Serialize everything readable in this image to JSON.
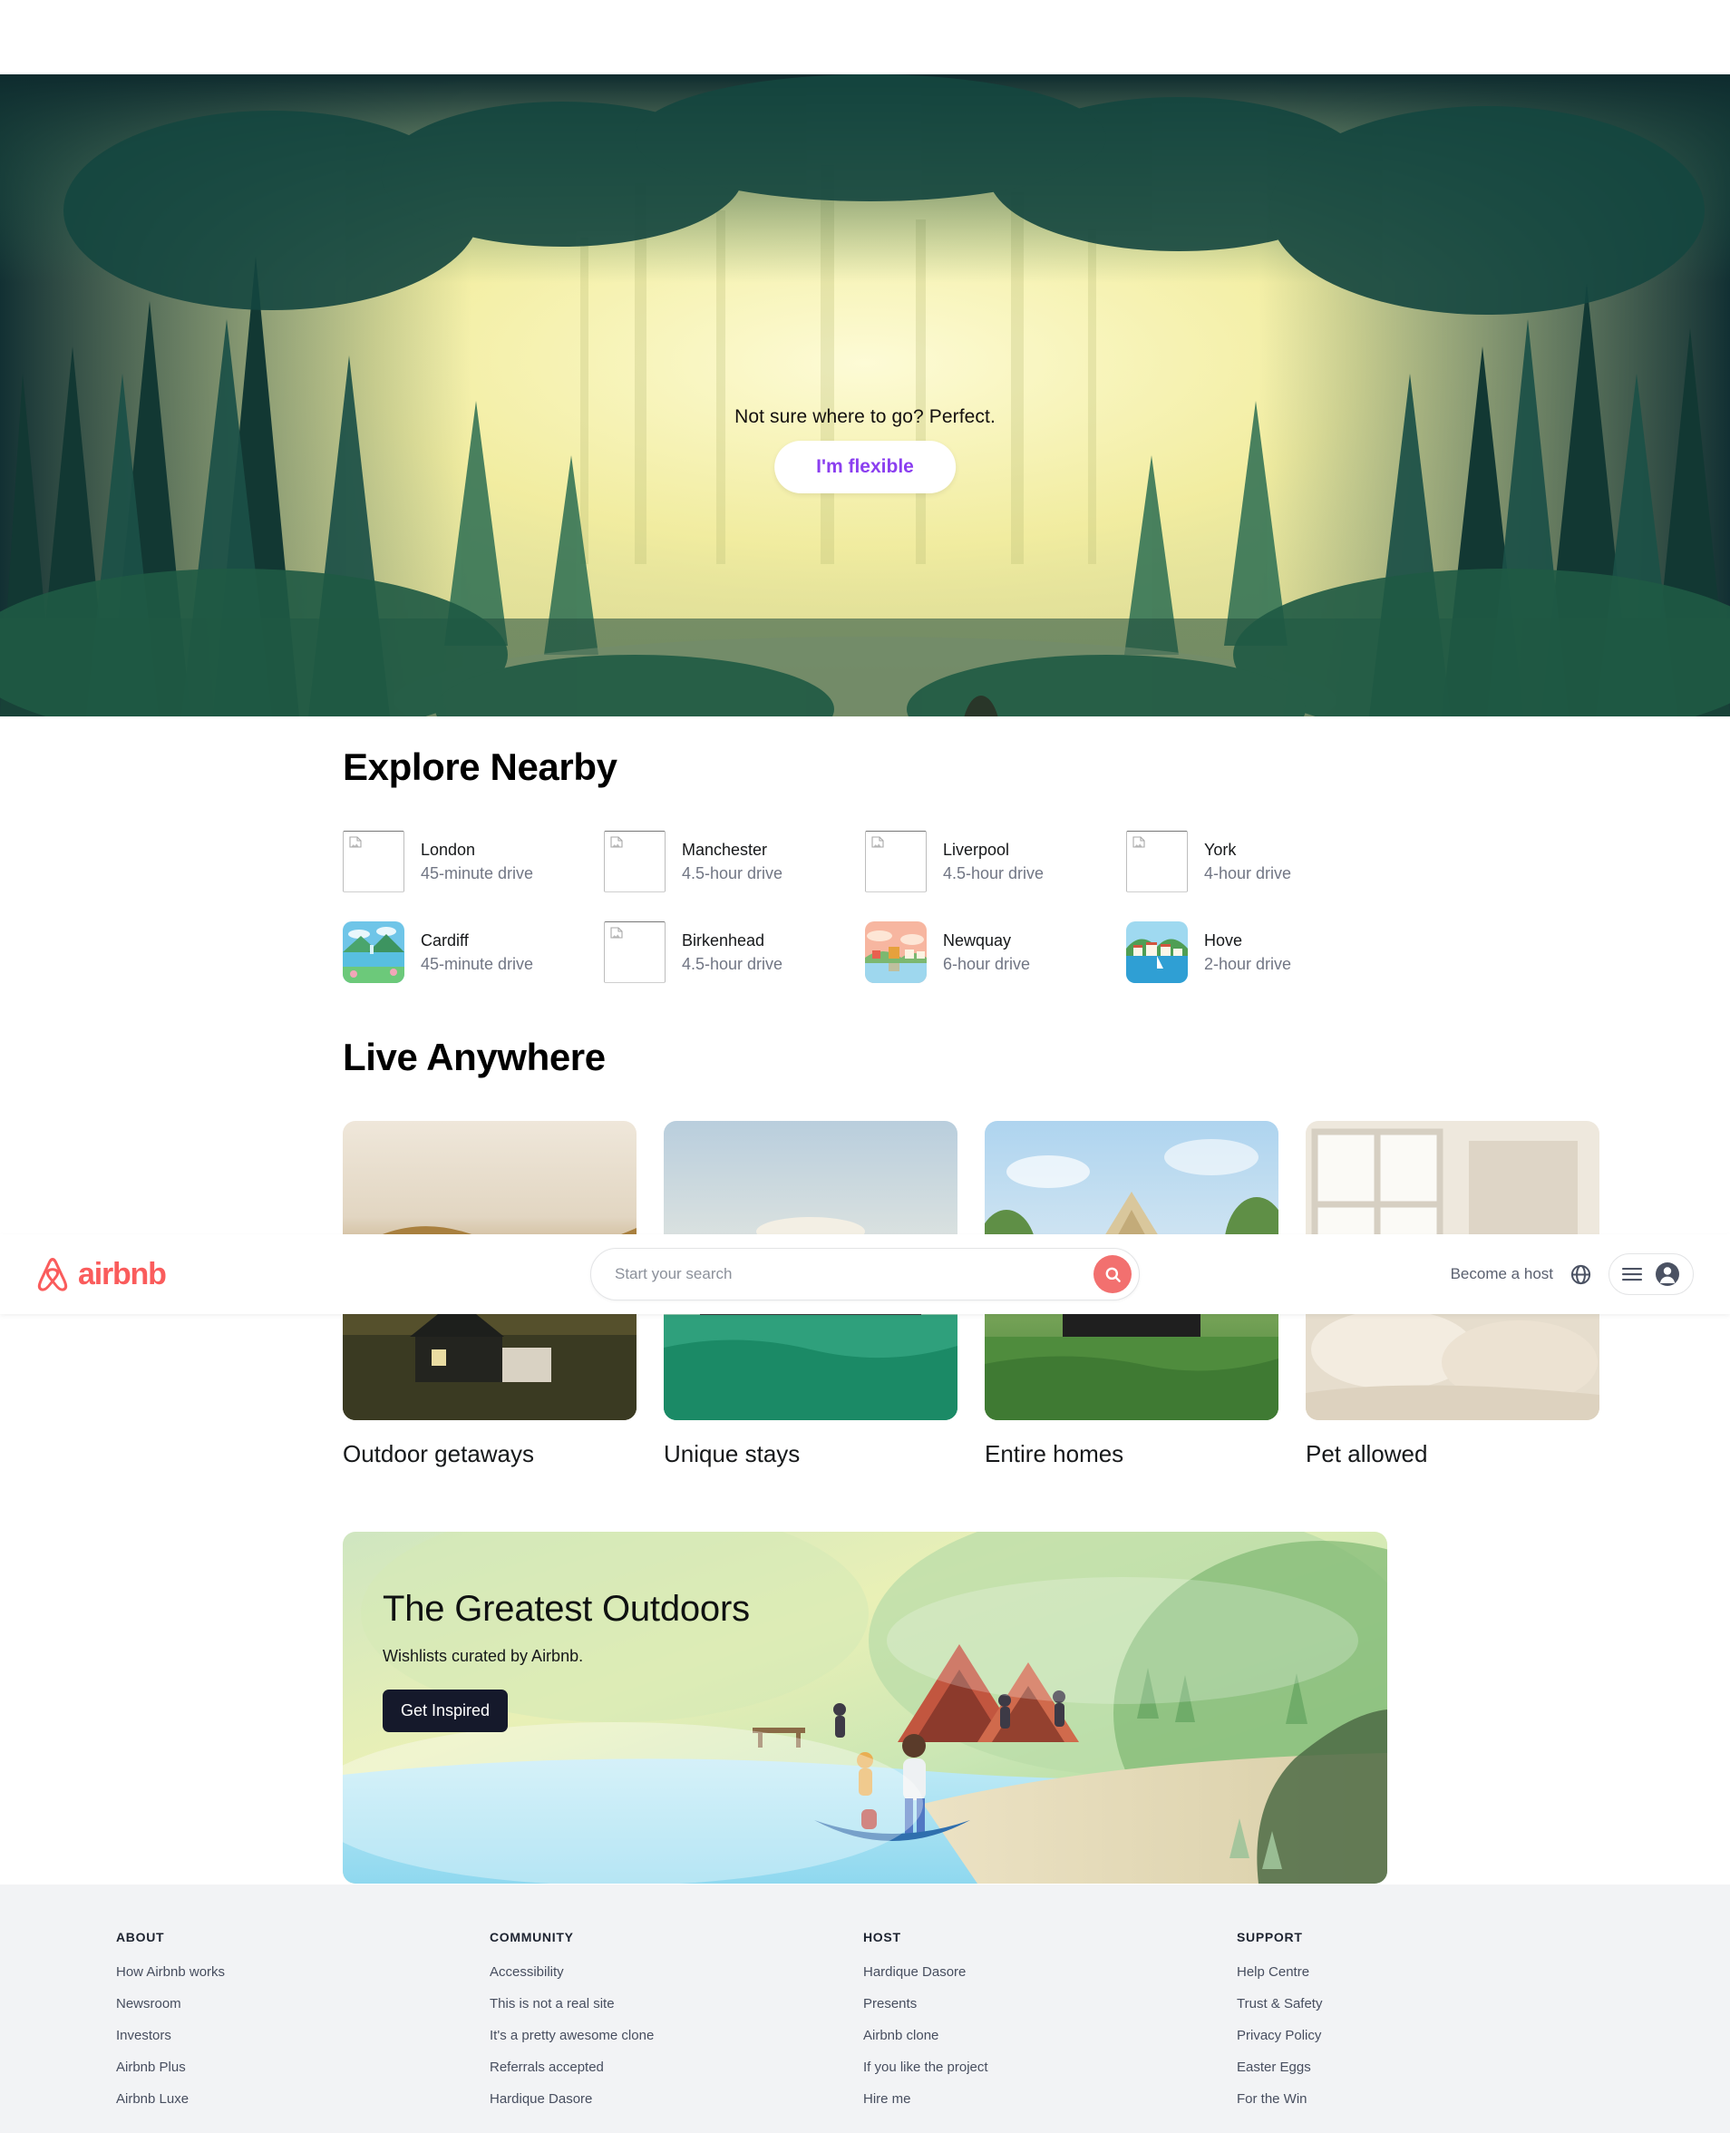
{
  "hero": {
    "tagline": "Not sure where to go? Perfect.",
    "button_label": "I'm flexible",
    "button_color": "#8b3ff0"
  },
  "header": {
    "brand_name": "airbnb",
    "brand_color": "#fa5c5c",
    "search_placeholder": "Start your search",
    "search_value": "",
    "become_host_label": "Become a host",
    "globe_icon": "globe-icon",
    "menu_icon": "hamburger-icon",
    "avatar_icon": "user-avatar-icon",
    "search_icon": "search-icon",
    "search_button_color": "#f2706f"
  },
  "explore": {
    "title": "Explore Nearby",
    "cards": [
      {
        "city": "London",
        "distance": "45-minute drive",
        "image": "broken"
      },
      {
        "city": "Manchester",
        "distance": "4.5-hour drive",
        "image": "broken"
      },
      {
        "city": "Liverpool",
        "distance": "4.5-hour drive",
        "image": "broken"
      },
      {
        "city": "York",
        "distance": "4-hour drive",
        "image": "broken"
      },
      {
        "city": "Cardiff",
        "distance": "45-minute drive",
        "image": "lake-mountains"
      },
      {
        "city": "Birkenhead",
        "distance": "4.5-hour drive",
        "image": "broken"
      },
      {
        "city": "Newquay",
        "distance": "6-hour drive",
        "image": "sunset-village"
      },
      {
        "city": "Hove",
        "distance": "2-hour drive",
        "image": "harbour-town"
      }
    ]
  },
  "live": {
    "title": "Live Anywhere",
    "cards": [
      {
        "label": "Outdoor getaways",
        "image": "hillside-cabin"
      },
      {
        "label": "Unique stays",
        "image": "modern-deck"
      },
      {
        "label": "Entire homes",
        "image": "a-frame-house"
      },
      {
        "label": "Pet allowed",
        "image": "cosy-bedroom"
      }
    ]
  },
  "promo": {
    "title": "The Greatest Outdoors",
    "subtitle": "Wishlists curated by Airbnb.",
    "button_label": "Get Inspired",
    "button_color": "#15192b"
  },
  "footer": {
    "columns": [
      {
        "heading": "ABOUT",
        "links": [
          "How Airbnb works",
          "Newsroom",
          "Investors",
          "Airbnb Plus",
          "Airbnb Luxe"
        ]
      },
      {
        "heading": "COMMUNITY",
        "links": [
          "Accessibility",
          "This is not a real site",
          "It's a pretty awesome clone",
          "Referrals accepted",
          "Hardique Dasore"
        ]
      },
      {
        "heading": "HOST",
        "links": [
          "Hardique Dasore",
          "Presents",
          "Airbnb clone",
          "If you like the project",
          "Hire me"
        ]
      },
      {
        "heading": "SUPPORT",
        "links": [
          "Help Centre",
          "Trust & Safety",
          "Privacy Policy",
          "Easter Eggs",
          "For the Win"
        ]
      }
    ]
  }
}
